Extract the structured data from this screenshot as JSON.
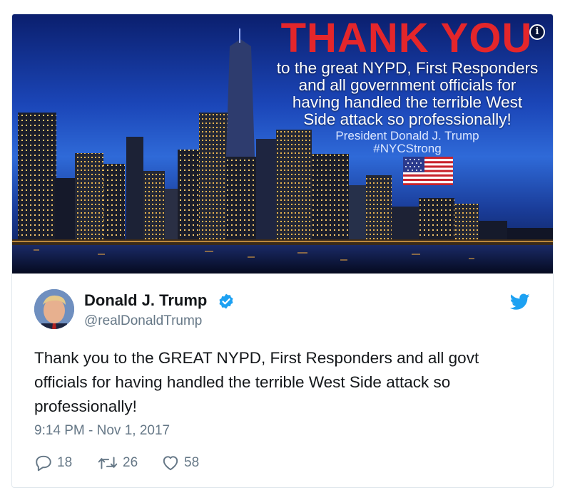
{
  "image": {
    "headline": "THANK YOU",
    "message_lines": [
      "to the great NYPD, First Responders",
      "and all government officials for",
      "having handled the terrible West",
      "Side attack so professionally!"
    ],
    "signature": "President Donald J. Trump",
    "hashtag": "#NYCStrong",
    "info_icon": "info-icon"
  },
  "author": {
    "name": "Donald J. Trump",
    "handle": "@realDonaldTrump",
    "verified": true
  },
  "tweet": {
    "text": "Thank you to the GREAT NYPD, First Responders and all govt officials for having handled the terrible West Side attack so professionally!",
    "timestamp": "9:14 PM - Nov 1, 2017"
  },
  "actions": {
    "reply_count": "18",
    "retweet_count": "26",
    "like_count": "58"
  },
  "colors": {
    "headline_red": "#e4262b",
    "twitter_blue": "#1da1f2",
    "secondary_text": "#657786",
    "border": "#e1e8ed"
  }
}
